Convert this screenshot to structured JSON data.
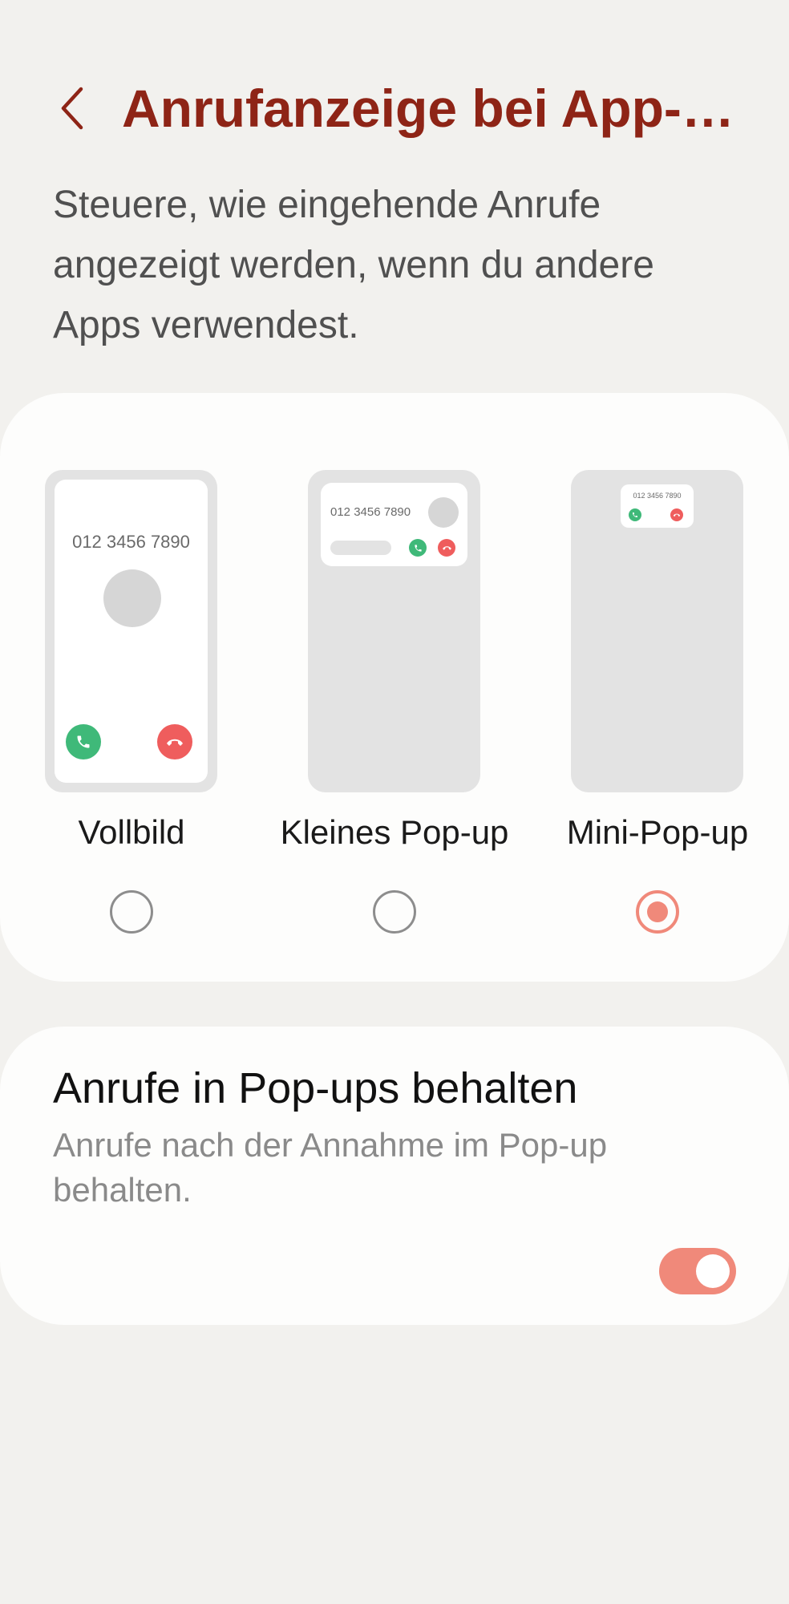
{
  "header": {
    "back_icon": "chevron-left-icon",
    "title": "Anrufanzeige bei App-…"
  },
  "description": "Steuere, wie eingehende Anrufe angezeigt werden, wenn du andere Apps verwendest.",
  "display_options": {
    "items": [
      {
        "label": "Vollbild",
        "preview_number": "012 3456 7890",
        "selected": false
      },
      {
        "label": "Kleines Pop-up",
        "preview_number": "012 3456 7890",
        "selected": false
      },
      {
        "label": "Mini-Pop-up",
        "preview_number": "012 3456 7890",
        "selected": true
      }
    ]
  },
  "keep_in_popup": {
    "title": "Anrufe in Pop-ups behalten",
    "subtitle": "Anrufe nach der Annahme im Pop-up behalten.",
    "enabled": true
  },
  "colors": {
    "title": "#8e2416",
    "accent": "#f0897a",
    "accept": "#3fb979",
    "decline": "#ef5d5d",
    "background": "#f2f1ee"
  }
}
